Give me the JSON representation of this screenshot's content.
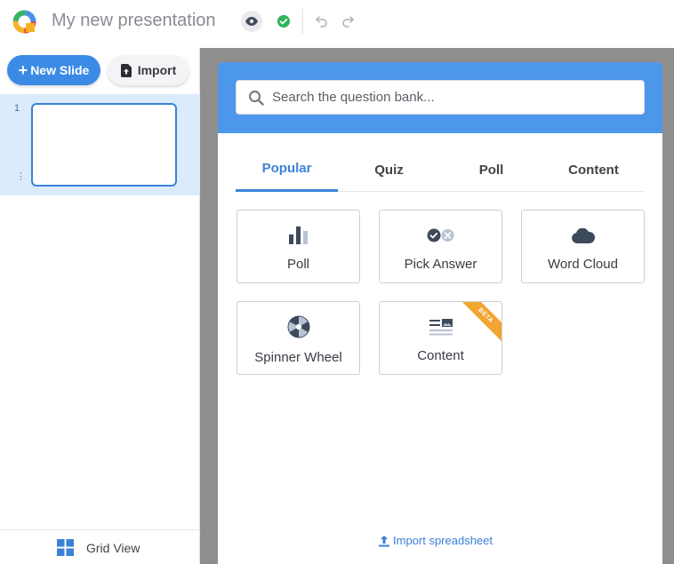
{
  "header": {
    "title": "My new presentation",
    "icons": {
      "logo": "app-logo",
      "preview": "eye-icon",
      "saved": "check-circle-icon",
      "undo": "undo-icon",
      "redo": "redo-icon"
    },
    "colors": {
      "saved": "#2fb457"
    }
  },
  "sidebar": {
    "new_slide_label": "New Slide",
    "import_label": "Import",
    "slides": [
      {
        "number": "1"
      }
    ],
    "grid_view_label": "Grid View"
  },
  "modal": {
    "search_placeholder": "Search the question bank...",
    "tabs": [
      {
        "label": "Popular",
        "active": true
      },
      {
        "label": "Quiz",
        "active": false
      },
      {
        "label": "Poll",
        "active": false
      },
      {
        "label": "Content",
        "active": false
      }
    ],
    "cards": [
      {
        "label": "Poll",
        "icon": "bar-chart-icon"
      },
      {
        "label": "Pick Answer",
        "icon": "check-x-icon"
      },
      {
        "label": "Word Cloud",
        "icon": "cloud-icon"
      },
      {
        "label": "Spinner Wheel",
        "icon": "spinner-wheel-icon"
      },
      {
        "label": "Content",
        "icon": "image-text-icon",
        "badge": "BETA"
      }
    ],
    "import_link_label": "Import spreadsheet"
  },
  "colors": {
    "accent": "#3b82d6",
    "header_blue": "#4d97ea",
    "beta": "#f2a531"
  }
}
